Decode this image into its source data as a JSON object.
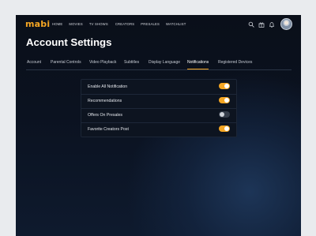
{
  "app": {
    "logo": "mabi",
    "nav": [
      "HOME",
      "MOVIES",
      "TV SHOWS",
      "CREATORS",
      "PRESALES",
      "WATCHLIST"
    ],
    "icons": [
      "search-icon",
      "gift-icon",
      "bell-icon"
    ]
  },
  "page": {
    "title": "Account Settings"
  },
  "tabs": [
    {
      "label": "Account",
      "active": false
    },
    {
      "label": "Parental Controls",
      "active": false
    },
    {
      "label": "Video Playback",
      "active": false
    },
    {
      "label": "Subtitles",
      "active": false
    },
    {
      "label": "Display Language",
      "active": false
    },
    {
      "label": "Notifications",
      "active": true
    },
    {
      "label": "Registered Devices",
      "active": false
    }
  ],
  "notifications": [
    {
      "label": "Enable All Notification",
      "enabled": true
    },
    {
      "label": "Recommendations",
      "enabled": true
    },
    {
      "label": "Offers On Presales",
      "enabled": false
    },
    {
      "label": "Favorite Creators Post",
      "enabled": true
    }
  ],
  "colors": {
    "accent": "#f5a623",
    "background": "#0b1220",
    "toggle_off": "#353d4a"
  }
}
